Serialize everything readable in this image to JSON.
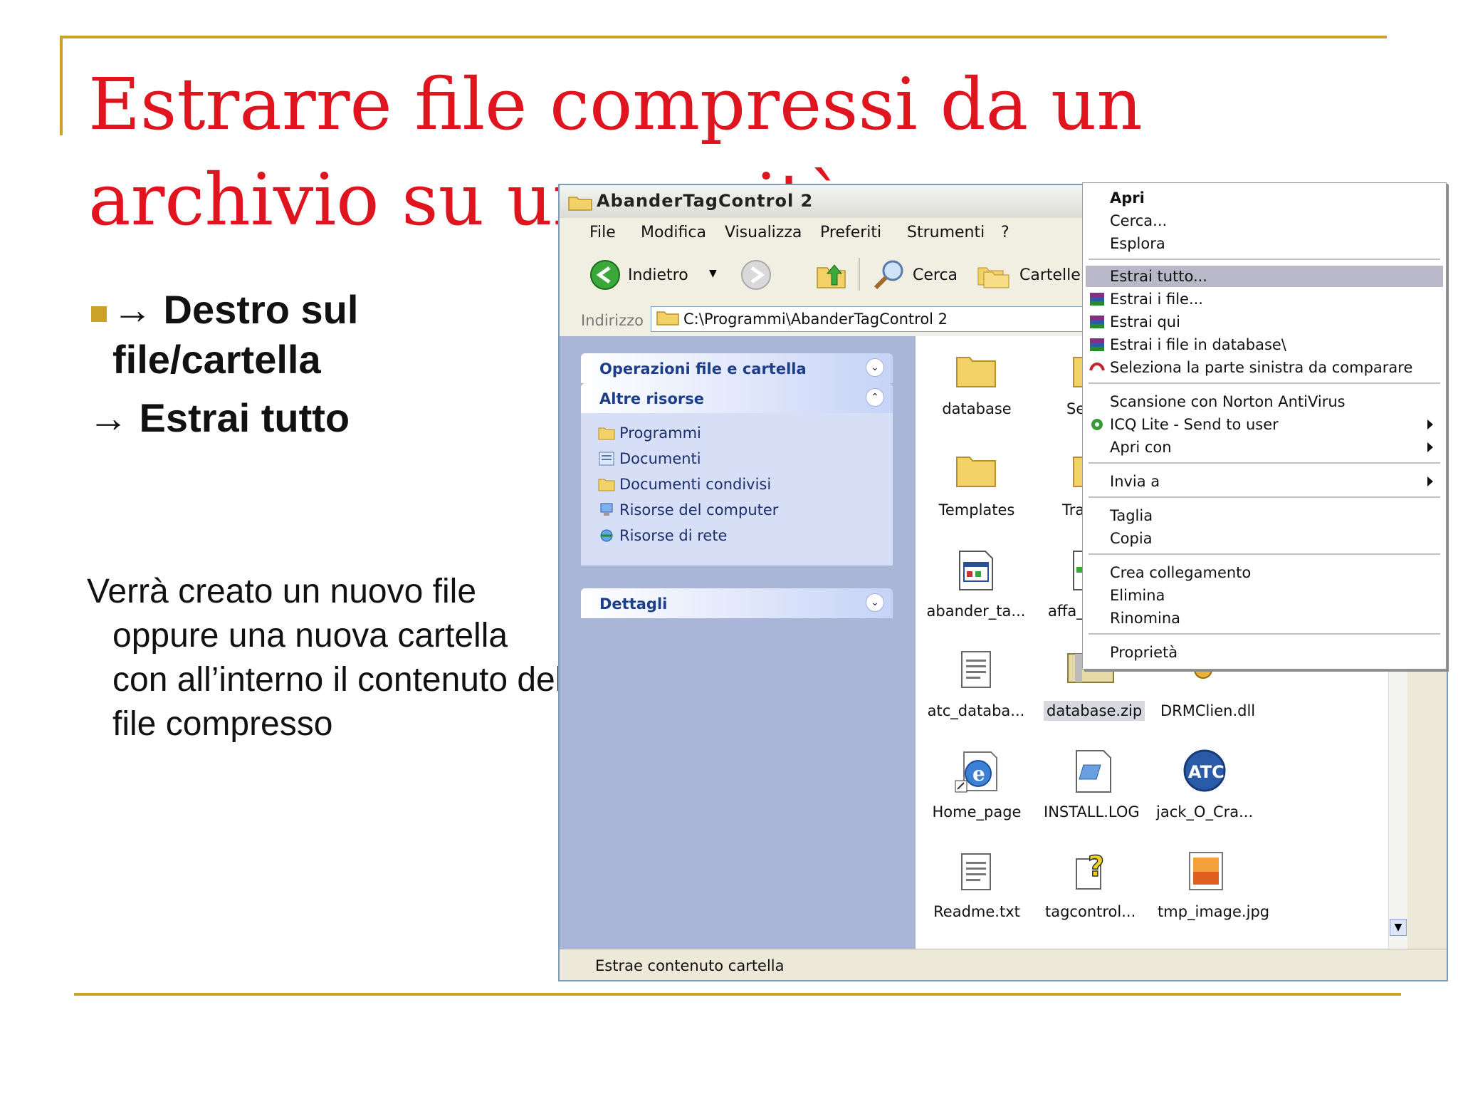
{
  "slide": {
    "title": "Estrarre file compressi da un archivio su una unità",
    "bullet_line1": "→ Destro sul",
    "bullet_line2": "file/cartella",
    "bullet_line3": "→ Estrai tutto",
    "description": "Verrà creato un nuovo file oppure una nuova cartella con all’interno il contenuto del file compresso"
  },
  "window": {
    "title": "AbanderTagControl 2",
    "menu": [
      "File",
      "Modifica",
      "Visualizza",
      "Preferiti",
      "Strumenti",
      "?"
    ],
    "toolbar": {
      "back": "Indietro",
      "search": "Cerca",
      "folders": "Cartelle"
    },
    "address": {
      "label": "Indirizzo",
      "value": "C:\\Programmi\\AbanderTagControl 2"
    },
    "taskpane": {
      "section1": "Operazioni file e cartella",
      "section2": "Altre risorse",
      "links": [
        "Programmi",
        "Documenti",
        "Documenti condivisi",
        "Risorse del computer",
        "Risorse di rete"
      ],
      "section3": "Dettagli"
    },
    "files": [
      {
        "name": "database",
        "icon": "folder-icon"
      },
      {
        "name": "Se",
        "icon": "folder-icon"
      },
      {
        "name": "Templates",
        "icon": "folder-icon"
      },
      {
        "name": "Tra",
        "icon": "folder-icon"
      },
      {
        "name": "abander_ta...",
        "icon": "app-window-icon"
      },
      {
        "name": "affa_",
        "icon": "file-icon"
      },
      {
        "name": "atc_databa...",
        "icon": "text-file-icon"
      },
      {
        "name": "database.zip",
        "icon": "zip-icon"
      },
      {
        "name": "DRMClien.dll",
        "icon": "dll-gear-icon"
      },
      {
        "name": "Home_page",
        "icon": "internet-explorer-icon"
      },
      {
        "name": "INSTALL.LOG",
        "icon": "log-file-icon"
      },
      {
        "name": "jack_O_Cra...",
        "icon": "atc-logo-icon"
      },
      {
        "name": "Readme.txt",
        "icon": "text-file-icon"
      },
      {
        "name": "tagcontrol...",
        "icon": "help-file-icon"
      },
      {
        "name": "tmp_image.jpg",
        "icon": "image-file-icon"
      }
    ],
    "status": "Estrae contenuto cartella"
  },
  "context_menu": {
    "apri": "Apri",
    "cerca": "Cerca...",
    "esplora": "Esplora",
    "estrai_tutto": "Estrai tutto...",
    "estrai_file": "Estrai i file...",
    "estrai_qui": "Estrai qui",
    "estrai_database": "Estrai i file in database\\",
    "seleziona": "Seleziona la parte sinistra da comparare",
    "norton": "Scansione con Norton AntiVirus",
    "icq": "ICQ Lite - Send to user",
    "apri_con": "Apri con",
    "invia_a": "Invia a",
    "taglia": "Taglia",
    "copia": "Copia",
    "collegamento": "Crea collegamento",
    "elimina": "Elimina",
    "rinomina": "Rinomina",
    "proprieta": "Proprietà"
  },
  "colors": {
    "title_red": "#e0141e",
    "accent_gold": "#c9a227",
    "highlight": "#b9b8c8"
  }
}
